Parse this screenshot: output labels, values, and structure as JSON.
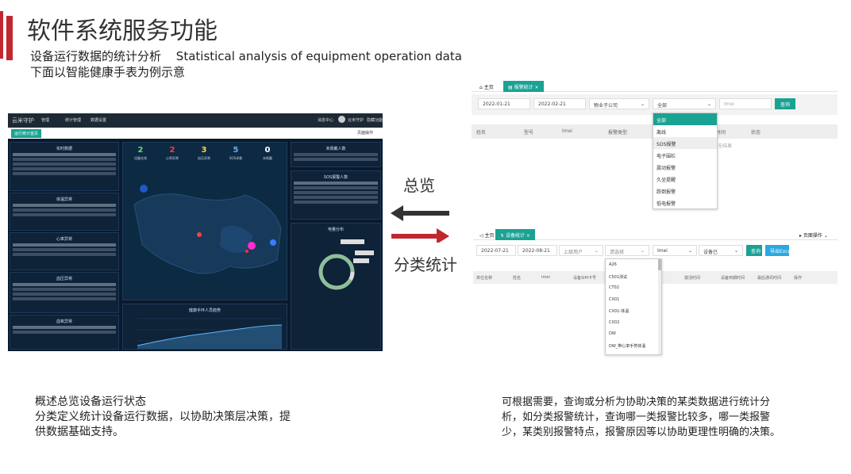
{
  "header": {
    "title": "软件系统服务功能",
    "subtitle_line1_cn": "设备运行数据的统计分析",
    "subtitle_line1_en": "Statistical analysis of equipment operation data",
    "subtitle_line2": "下面以智能健康手表为例示意"
  },
  "dashboard": {
    "app_name": "云米守护",
    "nav": [
      "管理",
      "统计管理",
      "数据设置"
    ],
    "user_menu": [
      "消息中心",
      "云米守护",
      "隐藏功能"
    ],
    "tab_label": "运行统计首页",
    "tab_ops": "页面操作",
    "stats": [
      {
        "value": "2",
        "label": "设备在线",
        "color": "#6dd36d"
      },
      {
        "value": "2",
        "label": "心率异常",
        "color": "#ff3b3b"
      },
      {
        "value": "3",
        "label": "血压异常",
        "color": "#ffd633"
      },
      {
        "value": "5",
        "label": "SOS求救",
        "color": "#6fa8ff"
      },
      {
        "value": "0",
        "label": "未佩戴",
        "color": "#ffffff"
      }
    ],
    "left_panels": [
      "实时数据",
      "体温异常",
      "心率异常",
      "血压异常",
      "血氧异常"
    ],
    "right_panels": [
      "未佩戴人数",
      "SOS报警人数",
      "电量分布"
    ],
    "bottom_panel": "健康手环人员趋势",
    "more": "更多"
  },
  "alarm_stats": {
    "tabs": {
      "home": "主页",
      "active": "报警统计"
    },
    "filters": {
      "date_from": "2022-01-21",
      "date_to": "2022-02-21",
      "company": "物业子公司",
      "type": "全部",
      "imei_placeholder": "Imei",
      "query": "查询"
    },
    "columns": [
      "姓名",
      "型号",
      "Imei",
      "报警类型",
      "时间",
      "状态"
    ],
    "empty_hint": "无结果",
    "dropdown": [
      "全部",
      "离线",
      "SOS报警",
      "电子围栏",
      "震动报警",
      "久坐提醒",
      "跌倒报警",
      "低电报警"
    ]
  },
  "device_stats": {
    "tabs": {
      "home": "主页",
      "active": "设备统计"
    },
    "tab_ops": "页面操作",
    "filters": {
      "date_from": "2022-07-21",
      "date_to": "2022-08-21",
      "customer": "上级用户",
      "model": "请选择",
      "imei": "Imei",
      "status": "设备已",
      "query": "查询",
      "export": "导出Excel"
    },
    "columns": [
      "单位名称",
      "姓名",
      "Imei",
      "设备SIM卡号",
      "激活时间",
      "设备到期时间",
      "最后通讯时间",
      "操作"
    ],
    "dropdown": [
      "A26",
      "C501测试",
      "CT02",
      "CX01",
      "CX01-体温",
      "CX02",
      "DW",
      "DW_带心率手势体温"
    ]
  },
  "arrows": {
    "overview": "总览",
    "classify": "分类统计"
  },
  "desc_left": [
    "概述总览设备运行状态",
    "分类定义统计设备运行数据，以协助决策层决策，提",
    "供数据基础支持。"
  ],
  "desc_right": [
    "可根据需要，查询或分析为协助决策的某类数据进行统计分",
    "析，如分类报警统计，查询哪一类报警比较多，哪一类报警",
    "少，某类别报警特点，报警原因等以协助更理性明确的决策。"
  ],
  "colors": {
    "brand_red": "#c0282e",
    "teal": "#1aa293",
    "blue_btn": "#2aa8e0",
    "dash_bg": "#0a1a2c"
  }
}
